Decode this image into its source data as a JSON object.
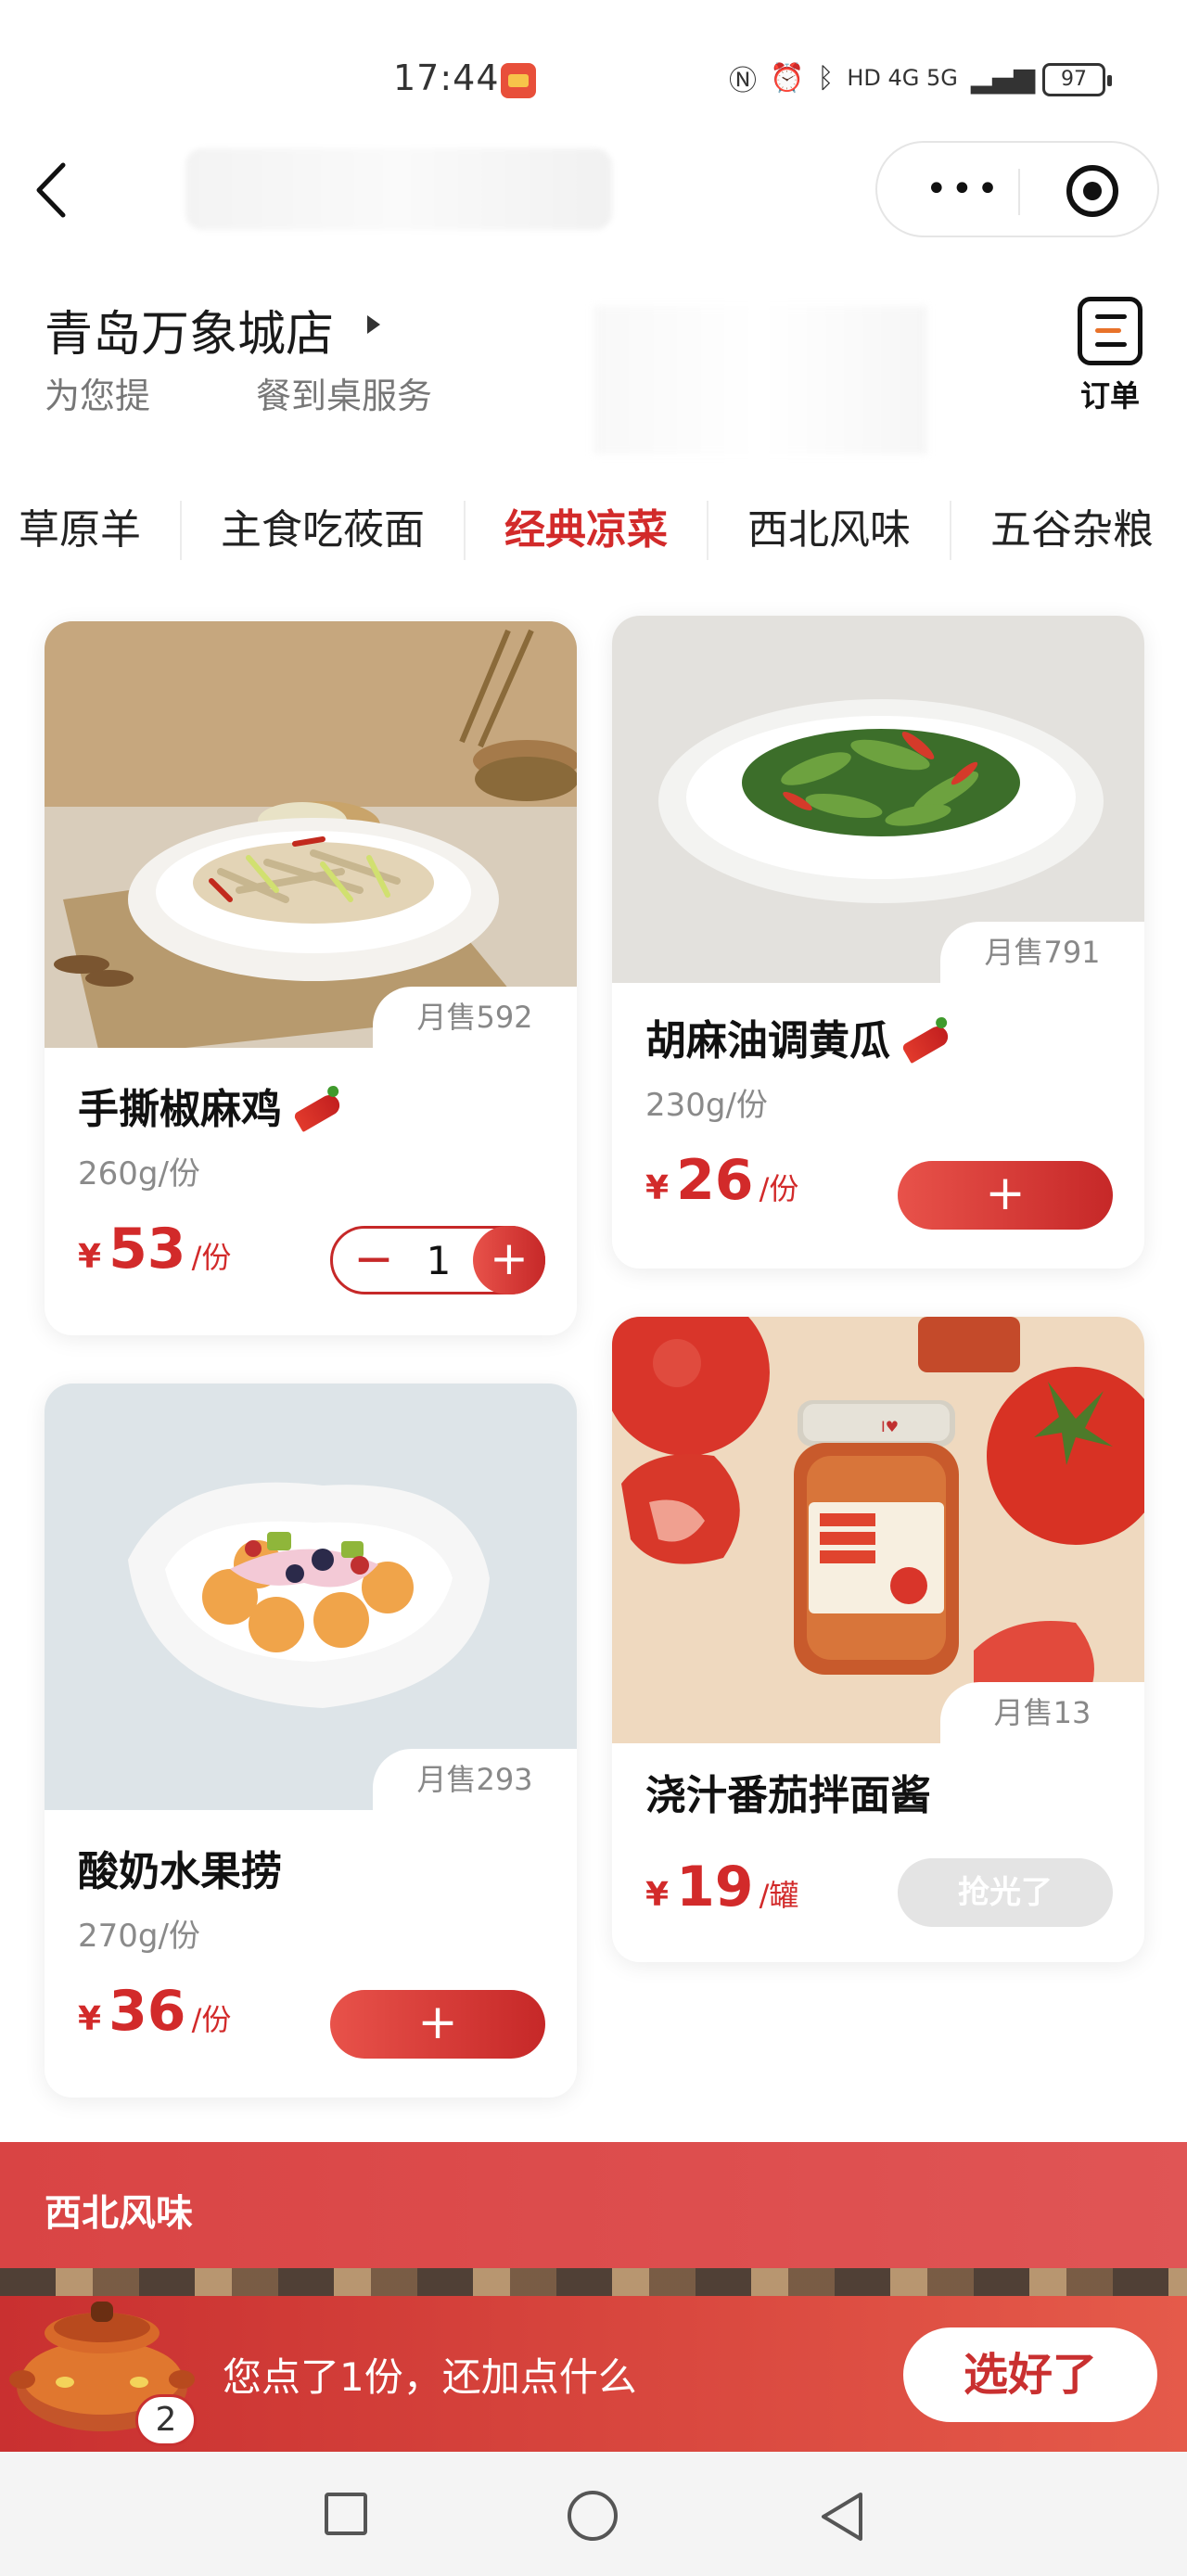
{
  "status_bar": {
    "time": "17:44",
    "network": "HD 4G 5G",
    "battery": "97"
  },
  "store": {
    "name": "青岛万象城店",
    "subtitle": "为您提　　　餐到桌服务",
    "order_label": "订单"
  },
  "tabs": [
    {
      "label": "草原羊",
      "active": false
    },
    {
      "label": "主食吃莜面",
      "active": false
    },
    {
      "label": "经典凉菜",
      "active": true
    },
    {
      "label": "西北风味",
      "active": false
    },
    {
      "label": "五谷杂粮",
      "active": false
    }
  ],
  "products": [
    {
      "name": "手撕椒麻鸡",
      "spicy": true,
      "spec": "260g/份",
      "currency": "¥",
      "price": "53",
      "unit": "/份",
      "monthly_sales": "月售592",
      "quantity": "1",
      "minus": "−",
      "plus": "+"
    },
    {
      "name": "胡麻油调黄瓜",
      "spicy": true,
      "spec": "230g/份",
      "currency": "¥",
      "price": "26",
      "unit": "/份",
      "monthly_sales": "月售791",
      "add": "+"
    },
    {
      "name": "酸奶水果捞",
      "spicy": false,
      "spec": "270g/份",
      "currency": "¥",
      "price": "36",
      "unit": "/份",
      "monthly_sales": "月售293",
      "add": "+"
    },
    {
      "name": "浇汁番茄拌面酱",
      "spicy": false,
      "currency": "¥",
      "price": "19",
      "unit": "/罐",
      "monthly_sales": "月售13",
      "sold_out": "抢光了"
    }
  ],
  "section": {
    "title": "西北风味"
  },
  "cart": {
    "count": "2",
    "message": "您点了1份，还加点什么",
    "checkout": "选好了"
  },
  "colors": {
    "accent": "#d22a2a",
    "cart_bar": "#c93030"
  }
}
